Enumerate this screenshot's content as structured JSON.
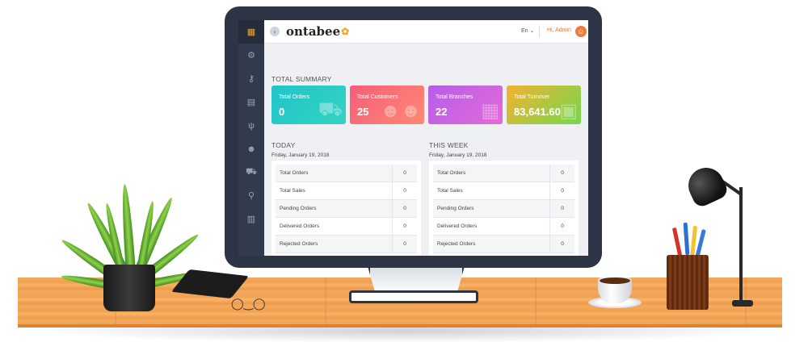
{
  "header": {
    "logo_text": "ontabee",
    "language": "En",
    "greeting": "Hi, Admin"
  },
  "sidebar": {
    "items": [
      {
        "icon": "grid-icon",
        "glyph": "▦"
      },
      {
        "icon": "gears-icon",
        "glyph": "⚙"
      },
      {
        "icon": "key-icon",
        "glyph": "⚷"
      },
      {
        "icon": "document-icon",
        "glyph": "▤"
      },
      {
        "icon": "cutlery-icon",
        "glyph": "ψ"
      },
      {
        "icon": "users-icon",
        "glyph": "☻"
      },
      {
        "icon": "cart-icon",
        "glyph": "⛟"
      },
      {
        "icon": "motorbike-icon",
        "glyph": "⚲"
      },
      {
        "icon": "bar-chart-icon",
        "glyph": "▥"
      }
    ]
  },
  "summary": {
    "title": "TOTAL SUMMARY",
    "cards": [
      {
        "label": "Total Orders",
        "value": "0",
        "icon": "cart-icon",
        "glyph": "🛒"
      },
      {
        "label": "Total Customers",
        "value": "25",
        "icon": "users-icon",
        "glyph": "👥"
      },
      {
        "label": "Total Branches",
        "value": "22",
        "icon": "building-icon",
        "glyph": "▦"
      },
      {
        "label": "Total Turnover",
        "value": "83,641.60",
        "icon": "money-icon",
        "glyph": "💵"
      }
    ]
  },
  "today": {
    "title": "TODAY",
    "date": "Friday, January 19, 2018",
    "rows": [
      {
        "name": "Total Orders",
        "value": "0"
      },
      {
        "name": "Total Sales",
        "value": "0"
      },
      {
        "name": "Pending Orders",
        "value": "0"
      },
      {
        "name": "Delivered Orders",
        "value": "0"
      },
      {
        "name": "Rejected Orders",
        "value": "0"
      }
    ]
  },
  "week": {
    "title": "THIS WEEK",
    "date": "Friday, January 19, 2018",
    "rows": [
      {
        "name": "Total Orders",
        "value": "0"
      },
      {
        "name": "Total Sales",
        "value": "0"
      },
      {
        "name": "Pending Orders",
        "value": "0"
      },
      {
        "name": "Delivered Orders",
        "value": "0"
      },
      {
        "name": "Rejected Orders",
        "value": "0"
      }
    ]
  }
}
